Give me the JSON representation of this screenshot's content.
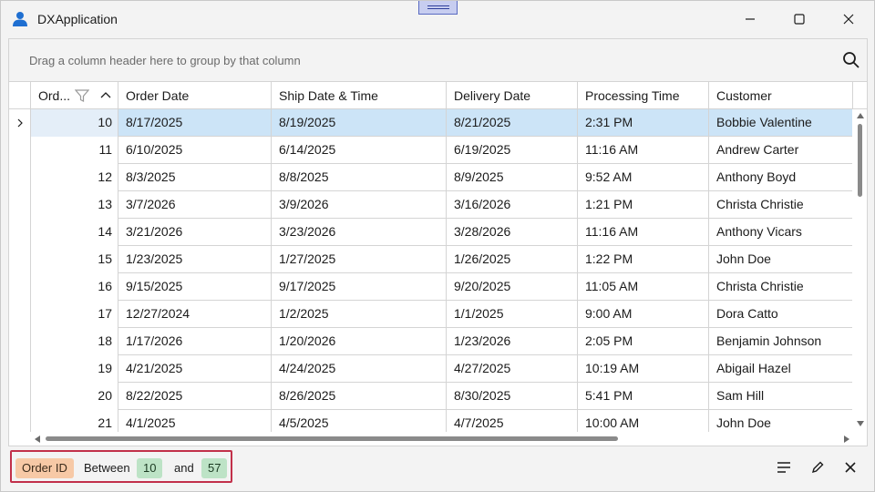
{
  "window": {
    "title": "DXApplication"
  },
  "group_panel": {
    "hint": "Drag a column header here to group by that column"
  },
  "columns": [
    {
      "label": "Ord..."
    },
    {
      "label": "Order Date"
    },
    {
      "label": "Ship Date & Time"
    },
    {
      "label": "Delivery Date"
    },
    {
      "label": "Processing Time"
    },
    {
      "label": "Customer"
    }
  ],
  "rows": [
    {
      "id": "10",
      "order_date": "8/17/2025",
      "ship_date": "8/19/2025",
      "delivery_date": "8/21/2025",
      "processing_time": "2:31 PM",
      "customer": "Bobbie Valentine",
      "selected": true
    },
    {
      "id": "11",
      "order_date": "6/10/2025",
      "ship_date": "6/14/2025",
      "delivery_date": "6/19/2025",
      "processing_time": "11:16 AM",
      "customer": "Andrew Carter"
    },
    {
      "id": "12",
      "order_date": "8/3/2025",
      "ship_date": "8/8/2025",
      "delivery_date": "8/9/2025",
      "processing_time": "9:52 AM",
      "customer": "Anthony Boyd"
    },
    {
      "id": "13",
      "order_date": "3/7/2026",
      "ship_date": "3/9/2026",
      "delivery_date": "3/16/2026",
      "processing_time": "1:21 PM",
      "customer": "Christa Christie"
    },
    {
      "id": "14",
      "order_date": "3/21/2026",
      "ship_date": "3/23/2026",
      "delivery_date": "3/28/2026",
      "processing_time": "11:16 AM",
      "customer": "Anthony Vicars"
    },
    {
      "id": "15",
      "order_date": "1/23/2025",
      "ship_date": "1/27/2025",
      "delivery_date": "1/26/2025",
      "processing_time": "1:22 PM",
      "customer": "John Doe"
    },
    {
      "id": "16",
      "order_date": "9/15/2025",
      "ship_date": "9/17/2025",
      "delivery_date": "9/20/2025",
      "processing_time": "11:05 AM",
      "customer": "Christa Christie"
    },
    {
      "id": "17",
      "order_date": "12/27/2024",
      "ship_date": "1/2/2025",
      "delivery_date": "1/1/2025",
      "processing_time": "9:00 AM",
      "customer": "Dora Catto"
    },
    {
      "id": "18",
      "order_date": "1/17/2026",
      "ship_date": "1/20/2026",
      "delivery_date": "1/23/2026",
      "processing_time": "2:05 PM",
      "customer": "Benjamin Johnson"
    },
    {
      "id": "19",
      "order_date": "4/21/2025",
      "ship_date": "4/24/2025",
      "delivery_date": "4/27/2025",
      "processing_time": "10:19 AM",
      "customer": "Abigail Hazel"
    },
    {
      "id": "20",
      "order_date": "8/22/2025",
      "ship_date": "8/26/2025",
      "delivery_date": "8/30/2025",
      "processing_time": "5:41 PM",
      "customer": "Sam Hill"
    },
    {
      "id": "21",
      "order_date": "4/1/2025",
      "ship_date": "4/5/2025",
      "delivery_date": "4/7/2025",
      "processing_time": "10:00 AM",
      "customer": "John Doe"
    }
  ],
  "filter": {
    "field": "Order ID",
    "operator": "Between",
    "value_from": "10",
    "conjunction": "and",
    "value_to": "57"
  },
  "icons": {
    "app": "user-icon",
    "search": "search-icon",
    "filter": "filter-icon",
    "sort": "sort-ascending-icon",
    "edit": "pencil-icon",
    "clear": "close-icon",
    "filter_menu": "menu-icon"
  },
  "colors": {
    "selected_row": "#cce4f7",
    "filter_border": "#c2304a",
    "field_token": "#f7c9a6",
    "value_token": "#bde3c6",
    "app_icon": "#1f6fd1"
  }
}
